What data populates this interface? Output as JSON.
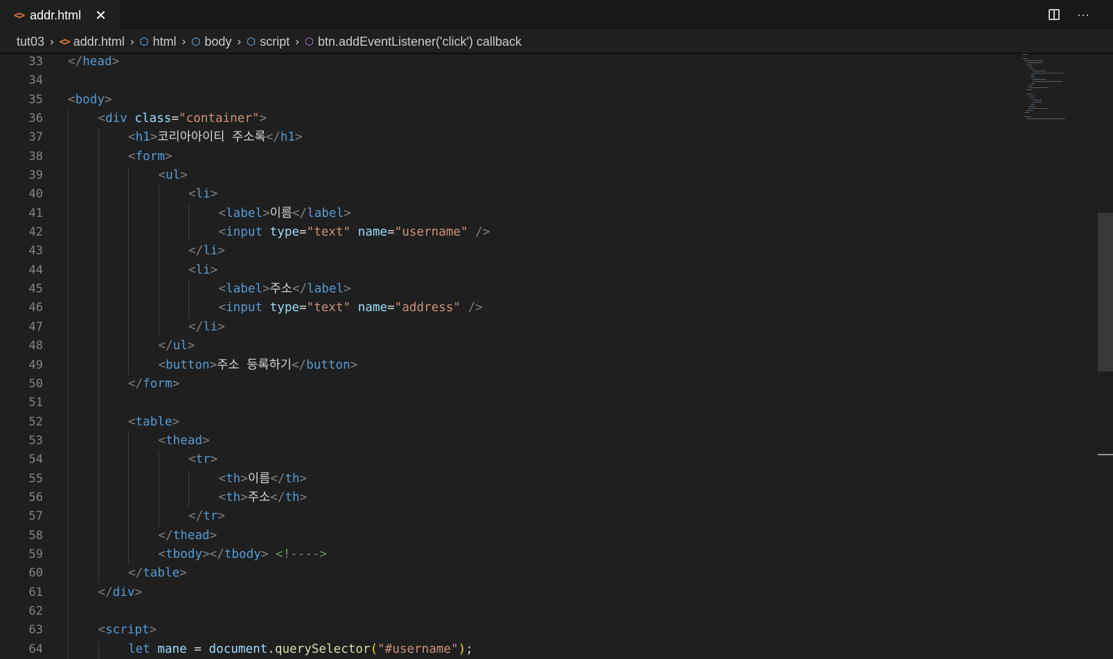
{
  "tab": {
    "label": "addr.html",
    "close": "✕",
    "icon": "html-file-icon"
  },
  "toolbar": {
    "split_icon": "split-editor-icon",
    "more": "···"
  },
  "breadcrumb": [
    {
      "label": "tut03",
      "icon": ""
    },
    {
      "label": "addr.html",
      "icon": "html-file-icon"
    },
    {
      "label": "html",
      "icon": "cube-icon"
    },
    {
      "label": "body",
      "icon": "cube-icon"
    },
    {
      "label": "script",
      "icon": "cube-icon"
    },
    {
      "label": "btn.addEventListener('click') callback",
      "icon": "method-icon"
    }
  ],
  "lines": [
    {
      "n": "33",
      "indent": 0,
      "tokens": [
        [
          "br",
          "</"
        ],
        [
          "tag",
          "head"
        ],
        [
          "br",
          ">"
        ]
      ]
    },
    {
      "n": "34",
      "indent": 0,
      "tokens": []
    },
    {
      "n": "35",
      "indent": 0,
      "tokens": [
        [
          "br",
          "<"
        ],
        [
          "tag",
          "body"
        ],
        [
          "br",
          ">"
        ]
      ]
    },
    {
      "n": "36",
      "indent": 1,
      "tokens": [
        [
          "br",
          "<"
        ],
        [
          "tag",
          "div"
        ],
        [
          "txt",
          " "
        ],
        [
          "attr",
          "class"
        ],
        [
          "txt",
          "="
        ],
        [
          "str",
          "\"container\""
        ],
        [
          "br",
          ">"
        ]
      ]
    },
    {
      "n": "37",
      "indent": 2,
      "tokens": [
        [
          "br",
          "<"
        ],
        [
          "tag",
          "h1"
        ],
        [
          "br",
          ">"
        ],
        [
          "txt",
          "코리아아이티 주소록"
        ],
        [
          "br",
          "</"
        ],
        [
          "tag",
          "h1"
        ],
        [
          "br",
          ">"
        ]
      ]
    },
    {
      "n": "38",
      "indent": 2,
      "tokens": [
        [
          "br",
          "<"
        ],
        [
          "tag",
          "form"
        ],
        [
          "br",
          ">"
        ]
      ]
    },
    {
      "n": "39",
      "indent": 3,
      "tokens": [
        [
          "br",
          "<"
        ],
        [
          "tag",
          "ul"
        ],
        [
          "br",
          ">"
        ]
      ]
    },
    {
      "n": "40",
      "indent": 4,
      "tokens": [
        [
          "br",
          "<"
        ],
        [
          "tag",
          "li"
        ],
        [
          "br",
          ">"
        ]
      ]
    },
    {
      "n": "41",
      "indent": 5,
      "tokens": [
        [
          "br",
          "<"
        ],
        [
          "tag",
          "label"
        ],
        [
          "br",
          ">"
        ],
        [
          "txt",
          "이름"
        ],
        [
          "br",
          "</"
        ],
        [
          "tag",
          "label"
        ],
        [
          "br",
          ">"
        ]
      ]
    },
    {
      "n": "42",
      "indent": 5,
      "tokens": [
        [
          "br",
          "<"
        ],
        [
          "tag",
          "input"
        ],
        [
          "txt",
          " "
        ],
        [
          "attr",
          "type"
        ],
        [
          "txt",
          "="
        ],
        [
          "str",
          "\"text\""
        ],
        [
          "txt",
          " "
        ],
        [
          "attr",
          "name"
        ],
        [
          "txt",
          "="
        ],
        [
          "str",
          "\"username\""
        ],
        [
          "txt",
          " "
        ],
        [
          "br",
          "/>"
        ]
      ]
    },
    {
      "n": "43",
      "indent": 4,
      "tokens": [
        [
          "br",
          "</"
        ],
        [
          "tag",
          "li"
        ],
        [
          "br",
          ">"
        ]
      ]
    },
    {
      "n": "44",
      "indent": 4,
      "tokens": [
        [
          "br",
          "<"
        ],
        [
          "tag",
          "li"
        ],
        [
          "br",
          ">"
        ]
      ]
    },
    {
      "n": "45",
      "indent": 5,
      "tokens": [
        [
          "br",
          "<"
        ],
        [
          "tag",
          "label"
        ],
        [
          "br",
          ">"
        ],
        [
          "txt",
          "주소"
        ],
        [
          "br",
          "</"
        ],
        [
          "tag",
          "label"
        ],
        [
          "br",
          ">"
        ]
      ]
    },
    {
      "n": "46",
      "indent": 5,
      "tokens": [
        [
          "br",
          "<"
        ],
        [
          "tag",
          "input"
        ],
        [
          "txt",
          " "
        ],
        [
          "attr",
          "type"
        ],
        [
          "txt",
          "="
        ],
        [
          "str",
          "\"text\""
        ],
        [
          "txt",
          " "
        ],
        [
          "attr",
          "name"
        ],
        [
          "txt",
          "="
        ],
        [
          "str",
          "\"address\""
        ],
        [
          "txt",
          " "
        ],
        [
          "br",
          "/>"
        ]
      ]
    },
    {
      "n": "47",
      "indent": 4,
      "tokens": [
        [
          "br",
          "</"
        ],
        [
          "tag",
          "li"
        ],
        [
          "br",
          ">"
        ]
      ]
    },
    {
      "n": "48",
      "indent": 3,
      "tokens": [
        [
          "br",
          "</"
        ],
        [
          "tag",
          "ul"
        ],
        [
          "br",
          ">"
        ]
      ]
    },
    {
      "n": "49",
      "indent": 3,
      "tokens": [
        [
          "br",
          "<"
        ],
        [
          "tag",
          "button"
        ],
        [
          "br",
          ">"
        ],
        [
          "txt",
          "주소 등록하기"
        ],
        [
          "br",
          "</"
        ],
        [
          "tag",
          "button"
        ],
        [
          "br",
          ">"
        ]
      ]
    },
    {
      "n": "50",
      "indent": 2,
      "tokens": [
        [
          "br",
          "</"
        ],
        [
          "tag",
          "form"
        ],
        [
          "br",
          ">"
        ]
      ]
    },
    {
      "n": "51",
      "indent": 0,
      "tokens": []
    },
    {
      "n": "52",
      "indent": 2,
      "tokens": [
        [
          "br",
          "<"
        ],
        [
          "tag",
          "table"
        ],
        [
          "br",
          ">"
        ]
      ]
    },
    {
      "n": "53",
      "indent": 3,
      "tokens": [
        [
          "br",
          "<"
        ],
        [
          "tag",
          "thead"
        ],
        [
          "br",
          ">"
        ]
      ]
    },
    {
      "n": "54",
      "indent": 4,
      "tokens": [
        [
          "br",
          "<"
        ],
        [
          "tag",
          "tr"
        ],
        [
          "br",
          ">"
        ]
      ]
    },
    {
      "n": "55",
      "indent": 5,
      "tokens": [
        [
          "br",
          "<"
        ],
        [
          "tag",
          "th"
        ],
        [
          "br",
          ">"
        ],
        [
          "txt",
          "이름"
        ],
        [
          "br",
          "</"
        ],
        [
          "tag",
          "th"
        ],
        [
          "br",
          ">"
        ]
      ]
    },
    {
      "n": "56",
      "indent": 5,
      "tokens": [
        [
          "br",
          "<"
        ],
        [
          "tag",
          "th"
        ],
        [
          "br",
          ">"
        ],
        [
          "txt",
          "주소"
        ],
        [
          "br",
          "</"
        ],
        [
          "tag",
          "th"
        ],
        [
          "br",
          ">"
        ]
      ]
    },
    {
      "n": "57",
      "indent": 4,
      "tokens": [
        [
          "br",
          "</"
        ],
        [
          "tag",
          "tr"
        ],
        [
          "br",
          ">"
        ]
      ]
    },
    {
      "n": "58",
      "indent": 3,
      "tokens": [
        [
          "br",
          "</"
        ],
        [
          "tag",
          "thead"
        ],
        [
          "br",
          ">"
        ]
      ]
    },
    {
      "n": "59",
      "indent": 3,
      "tokens": [
        [
          "br",
          "<"
        ],
        [
          "tag",
          "tbody"
        ],
        [
          "br",
          "></"
        ],
        [
          "tag",
          "tbody"
        ],
        [
          "br",
          ">"
        ],
        [
          "txt",
          " "
        ],
        [
          "cmt",
          "<!---->"
        ]
      ]
    },
    {
      "n": "60",
      "indent": 2,
      "tokens": [
        [
          "br",
          "</"
        ],
        [
          "tag",
          "table"
        ],
        [
          "br",
          ">"
        ]
      ]
    },
    {
      "n": "61",
      "indent": 1,
      "tokens": [
        [
          "br",
          "</"
        ],
        [
          "tag",
          "div"
        ],
        [
          "br",
          ">"
        ]
      ]
    },
    {
      "n": "62",
      "indent": 0,
      "tokens": []
    },
    {
      "n": "63",
      "indent": 1,
      "tokens": [
        [
          "br",
          "<"
        ],
        [
          "tag",
          "script"
        ],
        [
          "br",
          ">"
        ]
      ]
    },
    {
      "n": "64",
      "indent": 2,
      "tokens": [
        [
          "kw",
          "let"
        ],
        [
          "txt",
          " "
        ],
        [
          "var",
          "mane"
        ],
        [
          "op",
          " = "
        ],
        [
          "var",
          "document"
        ],
        [
          "op",
          "."
        ],
        [
          "fn",
          "querySelector"
        ],
        [
          "paren",
          "("
        ],
        [
          "str",
          "\"#username\""
        ],
        [
          "paren",
          ")"
        ],
        [
          "op",
          ";"
        ]
      ]
    }
  ]
}
